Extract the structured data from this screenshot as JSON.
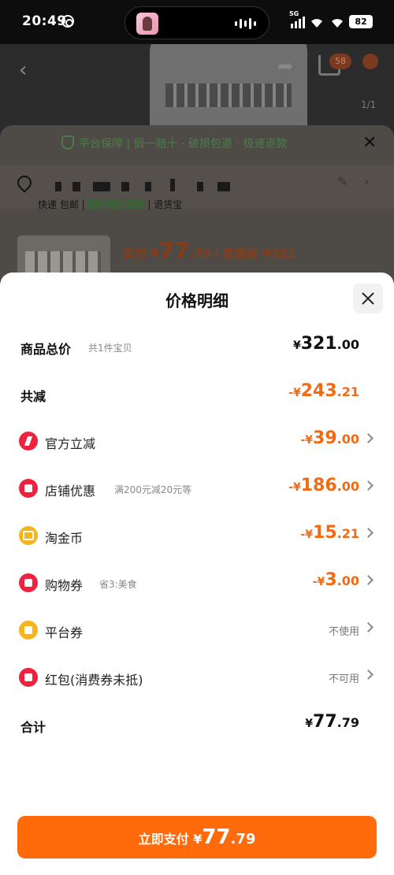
{
  "status_bar": {
    "time": "20:49",
    "network": "5G",
    "battery": "82"
  },
  "background": {
    "badge_cart": "58",
    "page_indicator": "1/1",
    "guarantee": "平台保障 | 假一赔十 · 破损包退 · 极速退款",
    "shipping": {
      "express": "快递 包邮",
      "eta": "预计明天发货",
      "return": "退货宝"
    },
    "price": {
      "actual_label": "实付",
      "yen": "¥",
      "int": "77",
      "dec": ".79",
      "original_label": "| 优惠前 ¥321"
    }
  },
  "modal": {
    "title": "价格明细",
    "rows": [
      {
        "label": "商品总价",
        "sub": "共1件宝贝",
        "yen": "¥",
        "int": "321",
        "dec": ".00"
      },
      {
        "label": "共减",
        "yen": "-¥",
        "int": "243",
        "dec": ".21"
      },
      {
        "label": "官方立减",
        "icon": "bolt-icon",
        "yen": "-¥",
        "int": "39",
        "dec": ".00"
      },
      {
        "label": "店铺优惠",
        "sub": "满200元减20元等",
        "icon": "store-icon",
        "yen": "-¥",
        "int": "186",
        "dec": ".00"
      },
      {
        "label": "淘金币",
        "icon": "gold-coin-icon",
        "yen": "-¥",
        "int": "15",
        "dec": ".21"
      },
      {
        "label": "购物券",
        "sub": "省3:美食",
        "icon": "ticket-icon",
        "yen": "-¥",
        "int": "3",
        "dec": ".00"
      },
      {
        "label": "平台券",
        "icon": "coupon-icon",
        "value": "不使用"
      },
      {
        "label": "红包(消费券未抵)",
        "icon": "red-packet-icon",
        "value": "不可用"
      },
      {
        "label": "合计",
        "yen": "¥",
        "int": "77",
        "dec": ".79"
      }
    ],
    "pay_button": {
      "label": "立即支付",
      "yen": "¥",
      "int": "77",
      "dec": ".79"
    }
  },
  "colors": {
    "accent": "#ff6a0b",
    "discount": "#f26a12",
    "icon_red": "#f0233f",
    "icon_yellow": "#f6b51d"
  }
}
